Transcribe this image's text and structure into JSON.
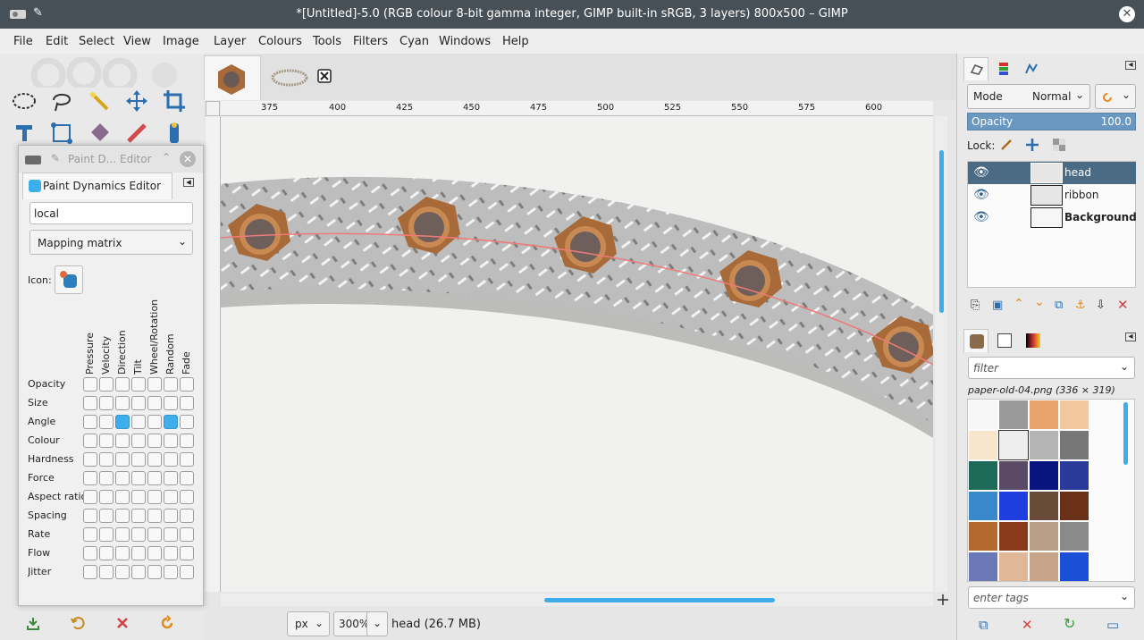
{
  "window": {
    "title": "*[Untitled]-5.0 (RGB colour 8-bit gamma integer, GIMP built-in sRGB, 3 layers) 800x500 – GIMP",
    "icons": [
      "gimp-app-icon",
      "pin-icon",
      "close-icon"
    ]
  },
  "menu": [
    "File",
    "Edit",
    "Select",
    "View",
    "Image",
    "Layer",
    "Colours",
    "Tools",
    "Filters",
    "Cyan",
    "Windows",
    "Help"
  ],
  "ruler": {
    "ticks": [
      "375",
      "400",
      "425",
      "450",
      "475",
      "500",
      "525",
      "550",
      "575",
      "600"
    ]
  },
  "status": {
    "unit": "px",
    "zoom": "300%",
    "layer_info": "head (26.7 MB)"
  },
  "paint_dynamics": {
    "dialog_title": "Paint D... Editor",
    "tab_label": "Paint Dynamics Editor",
    "name_value": "local",
    "mode_value": "Mapping matrix",
    "icon_label": "Icon:",
    "columns": [
      "Pressure",
      "Velocity",
      "Direction",
      "Tilt",
      "Wheel/Rotation",
      "Random",
      "Fade"
    ],
    "rows": [
      "Opacity",
      "Size",
      "Angle",
      "Colour",
      "Hardness",
      "Force",
      "Aspect ratio",
      "Spacing",
      "Rate",
      "Flow",
      "Jitter"
    ],
    "checked": [
      [
        2,
        2
      ],
      [
        2,
        5
      ]
    ]
  },
  "layers_panel": {
    "mode_label": "Mode",
    "mode_value": "Normal",
    "opacity_label": "Opacity",
    "opacity_value": "100.0",
    "lock_label": "Lock:",
    "layers": [
      {
        "name": "head",
        "selected": true,
        "visible": true
      },
      {
        "name": "ribbon",
        "selected": false,
        "visible": true
      },
      {
        "name": "Background",
        "selected": false,
        "visible": true
      }
    ]
  },
  "patterns_panel": {
    "filter_placeholder": "filter",
    "current_pattern": "paper-old-04.png (336 × 319)",
    "tags_placeholder": "enter tags",
    "swatch_colors": [
      "#f6f6f6",
      "#9a9a9a",
      "#e8a46c",
      "#f2c8a0",
      "#f8e6cc",
      "#eeeeee",
      "#b4b4b4",
      "#777777",
      "#1e6a58",
      "#5a4a66",
      "#0a1480",
      "#2a3a9a",
      "#3a88cc",
      "#1e3ee0",
      "#6a4a38",
      "#6a3018",
      "#b46a2e",
      "#8a3a1a",
      "#b8a088",
      "#8a8a8a",
      "#6a78b8",
      "#e0b898",
      "#c8a488",
      "#1a50d8"
    ]
  },
  "colors": {
    "titlebar": "#475057",
    "selection": "#4b6b85",
    "accent": "#3daee9"
  }
}
